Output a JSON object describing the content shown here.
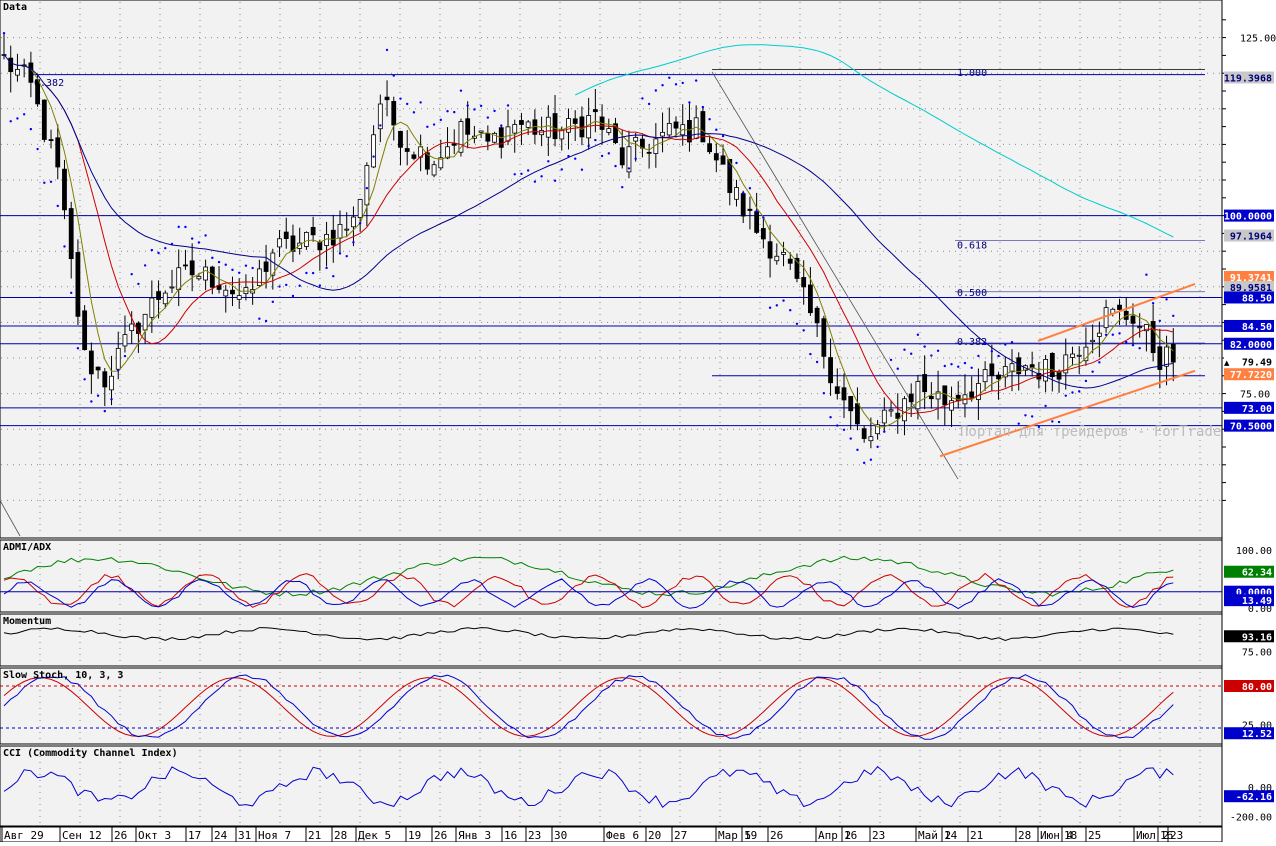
{
  "chart_data": {
    "type": "candlestick",
    "watermark": "Портал для трейдеров - ForTrader.ru",
    "dates": [
      "Авг 29",
      "Сен 12",
      "26",
      "Окт 3",
      "17",
      "24",
      "31",
      "Ноя 7",
      "21",
      "28",
      "Дек 5",
      "19",
      "26",
      "Янв 3",
      "16",
      "23",
      "30",
      "Фев 6",
      "20",
      "27",
      "Мар 5",
      "19",
      "26",
      "Апр 2",
      "16",
      "23",
      "Май 2",
      "14",
      "21",
      "28",
      "Июн 4",
      "18",
      "25",
      "Июл 2",
      "16",
      "23"
    ],
    "main": {
      "title": "Data",
      "ylim": [
        55,
        130
      ],
      "axis_labels": [
        "125.00",
        "75.00"
      ],
      "levels": [
        {
          "price": 119.3968,
          "label": "119.3968",
          "box": "#c8c8c8",
          "text": "#00007a"
        },
        {
          "price": 100.0,
          "label": "100.0000",
          "box": "#0000cc",
          "text": "#ffffff"
        },
        {
          "price": 97.1964,
          "label": "97.1964",
          "box": "#c8c8c8",
          "text": "#00007a"
        },
        {
          "price": 91.3741,
          "label": "91.3741",
          "box": "#ff8040",
          "text": "#ffffff"
        },
        {
          "price": 89.9581,
          "label": "89.9581",
          "box": "#c8c8c8",
          "text": "#00007a"
        },
        {
          "price": 88.5,
          "label": "88.50",
          "box": "#0000cc",
          "text": "#ffffff"
        },
        {
          "price": 84.5,
          "label": "84.50",
          "box": "#0000cc",
          "text": "#ffffff"
        },
        {
          "price": 82.0,
          "label": "82.0000",
          "box": "#0000cc",
          "text": "#ffffff"
        },
        {
          "price": 79.49,
          "label": "79.49",
          "box": "#ffffff",
          "text": "#000000"
        },
        {
          "price": 77.722,
          "label": "77.7220",
          "box": "#ff8040",
          "text": "#ffffff"
        },
        {
          "price": 73.0,
          "label": "73.00",
          "box": "#0000cc",
          "text": "#ffffff"
        },
        {
          "price": 70.5,
          "label": "70.5000",
          "box": "#0000cc",
          "text": "#ffffff"
        }
      ],
      "fib_labels": [
        {
          "text": "0.382",
          "price": 118.2
        },
        {
          "text": "1.000",
          "price": 119.6
        },
        {
          "text": "0.618",
          "price": 95.4
        },
        {
          "text": "0.500",
          "price": 88.7
        },
        {
          "text": "0.382",
          "price": 81.8
        }
      ],
      "horizontal_lines": [
        119.8,
        100.0,
        88.5,
        84.5,
        82.0,
        77.5,
        73.0,
        70.5
      ],
      "series": {
        "close_anchors": [
          [
            0,
            122
          ],
          [
            4,
            118
          ],
          [
            8,
            106
          ],
          [
            12,
            80
          ],
          [
            15,
            77
          ],
          [
            20,
            85
          ],
          [
            24,
            90
          ],
          [
            28,
            92
          ],
          [
            32,
            91
          ],
          [
            36,
            88
          ],
          [
            40,
            95
          ],
          [
            44,
            96
          ],
          [
            48,
            97
          ],
          [
            52,
            99
          ],
          [
            56,
            116
          ],
          [
            60,
            110
          ],
          [
            64,
            108
          ],
          [
            68,
            112
          ],
          [
            72,
            110
          ],
          [
            76,
            113
          ],
          [
            80,
            112
          ],
          [
            84,
            112
          ],
          [
            88,
            114
          ],
          [
            92,
            108
          ],
          [
            96,
            110
          ],
          [
            100,
            112
          ],
          [
            104,
            112
          ],
          [
            108,
            104
          ],
          [
            112,
            98
          ],
          [
            116,
            94
          ],
          [
            120,
            86
          ],
          [
            124,
            76
          ],
          [
            128,
            68
          ],
          [
            132,
            72
          ],
          [
            136,
            76
          ],
          [
            140,
            74
          ],
          [
            144,
            76
          ],
          [
            148,
            77
          ],
          [
            152,
            79
          ],
          [
            156,
            78
          ],
          [
            160,
            82
          ],
          [
            164,
            86
          ],
          [
            168,
            86
          ],
          [
            172,
            80
          ]
        ],
        "colors": {
          "ma_fast": "#808000",
          "ma_mid": "#cc0000",
          "ma_slow": "#00008b",
          "ma_long": "#00cccc",
          "psar": "#0000ff",
          "channel": "#ff8040"
        }
      }
    },
    "panels": [
      {
        "title": "ADMI/ADX",
        "ylim": [
          0,
          100
        ],
        "axis_labels": [
          "100.00",
          "0.00"
        ],
        "boxes": [
          {
            "label": "62.34",
            "value": 62.34,
            "box": "#008000"
          },
          {
            "label": "0.0000",
            "value": 28.0,
            "box": "#0000cc"
          },
          {
            "label": "13.49",
            "value": 13.49,
            "box": "#0000cc"
          }
        ]
      },
      {
        "title": "Momentum",
        "ylim": [
          60,
          115
        ],
        "axis_labels": [
          "75.00"
        ],
        "boxes": [
          {
            "label": "93.16",
            "value": 93.16,
            "box": "#000000"
          }
        ]
      },
      {
        "title": "Slow Stoch, 10, 3, 3",
        "ylim": [
          0,
          100
        ],
        "axis_labels": [
          "25.00"
        ],
        "boxes": [
          {
            "label": "80.00",
            "value": 80.0,
            "box": "#cc0000"
          },
          {
            "label": "12.52",
            "value": 12.52,
            "box": "#0000cc"
          }
        ]
      },
      {
        "title": "CCI (Commodity Channel Index)",
        "ylim": [
          -250,
          250
        ],
        "axis_labels": [
          "0.00",
          "-200.00"
        ],
        "boxes": [
          {
            "label": "-62.16",
            "value": -62.16,
            "box": "#0000cc"
          }
        ]
      }
    ]
  }
}
